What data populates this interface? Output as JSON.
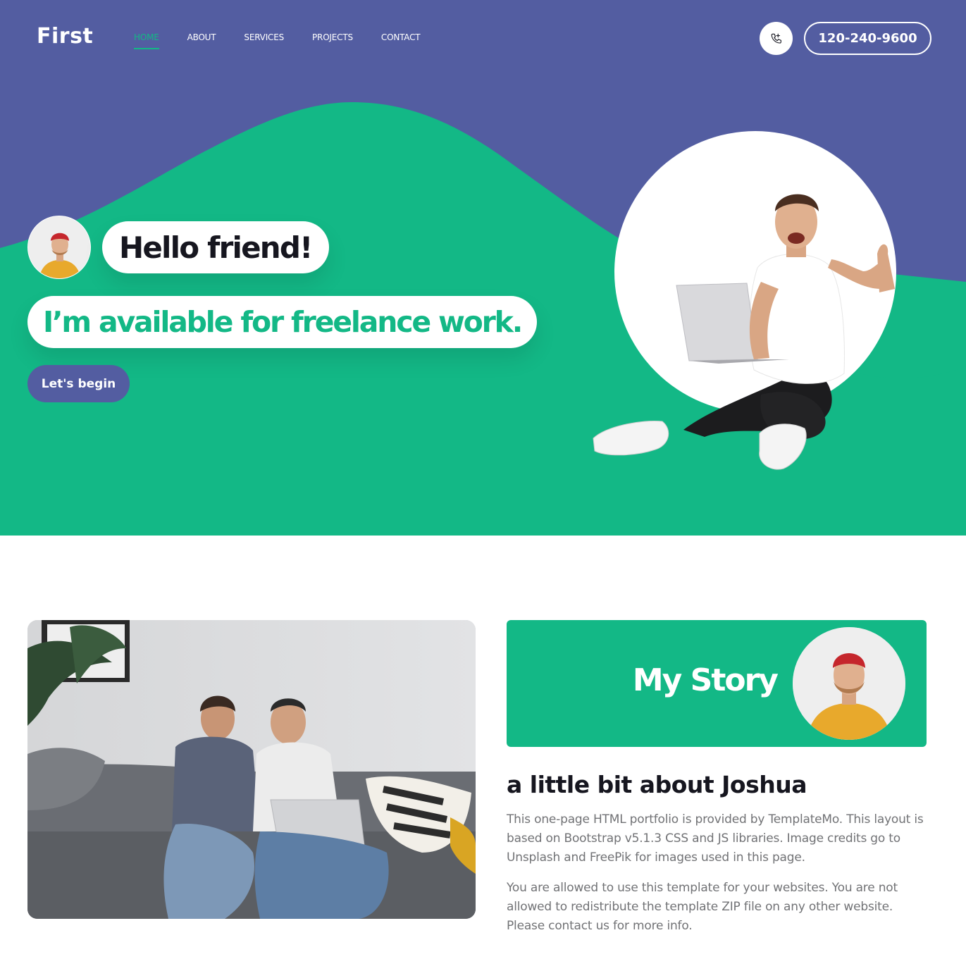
{
  "brand": "First",
  "nav": {
    "items": [
      "HOME",
      "ABOUT",
      "SERVICES",
      "PROJECTS",
      "CONTACT"
    ],
    "active_index": 0
  },
  "phone": {
    "number": "120-240-9600",
    "icon": "phone-icon"
  },
  "hero": {
    "greeting": "Hello friend!",
    "tagline": "I’m available for freelance work.",
    "cta": "Let's begin"
  },
  "about": {
    "card_title": "My Story",
    "heading": "a little bit about Joshua",
    "paragraph_1": "This one-page HTML portfolio is provided by TemplateMo. This layout is based on Bootstrap v5.1.3 CSS and JS libraries. Image credits go to Unsplash and FreePik for images used in this page.",
    "paragraph_2": "You are allowed to use this template for your websites. You are not allowed to redistribute the template ZIP file on any other website. Please contact us for more info."
  },
  "colors": {
    "primary_blue": "#535da1",
    "accent_green": "#13b886",
    "text_dark": "#16161f",
    "text_muted": "#717275"
  }
}
